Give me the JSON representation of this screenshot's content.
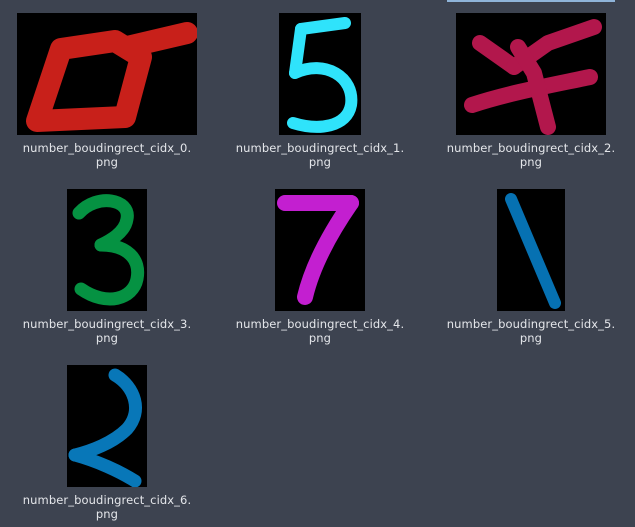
{
  "files": [
    {
      "name_line1": "number_boudingrect_cidx_0.",
      "name_line2": "png",
      "icon": "digit-4-thumbnail",
      "color": "#c8201a"
    },
    {
      "name_line1": "number_boudingrect_cidx_1.",
      "name_line2": "png",
      "icon": "digit-5-thumbnail",
      "color": "#2fe3fb"
    },
    {
      "name_line1": "number_boudingrect_cidx_2.",
      "name_line2": "png",
      "icon": "digit-4-thumbnail",
      "color": "#b2174c"
    },
    {
      "name_line1": "number_boudingrect_cidx_3.",
      "name_line2": "png",
      "icon": "digit-3-thumbnail",
      "color": "#059242"
    },
    {
      "name_line1": "number_boudingrect_cidx_4.",
      "name_line2": "png",
      "icon": "digit-7-thumbnail",
      "color": "#c31fd0"
    },
    {
      "name_line1": "number_boudingrect_cidx_5.",
      "name_line2": "png",
      "icon": "digit-1-thumbnail",
      "color": "#0671b2"
    },
    {
      "name_line1": "number_boudingrect_cidx_6.",
      "name_line2": "png",
      "icon": "digit-2-thumbnail",
      "color": "#0877b8"
    }
  ]
}
